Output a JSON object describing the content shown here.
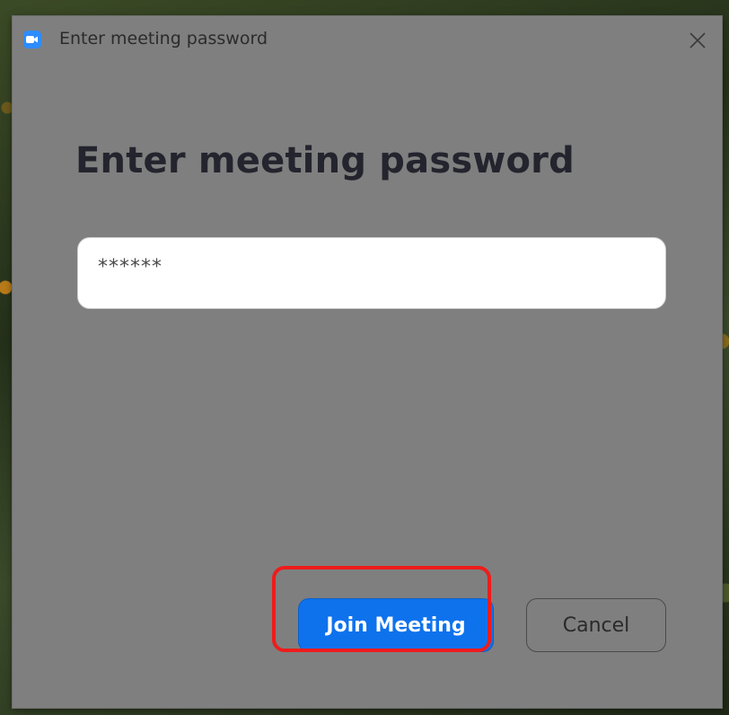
{
  "window": {
    "title": "Enter meeting password",
    "app_icon": "zoom-camera-icon",
    "close_icon": "close-icon"
  },
  "dialog": {
    "heading": "Enter meeting password",
    "password_value": "******"
  },
  "buttons": {
    "join_label": "Join Meeting",
    "cancel_label": "Cancel"
  },
  "colors": {
    "dialog_bg": "#7f7f7f",
    "join_button": "#0e72ed",
    "highlight_box": "#ee1c1c",
    "app_icon": "#2d8cff"
  }
}
